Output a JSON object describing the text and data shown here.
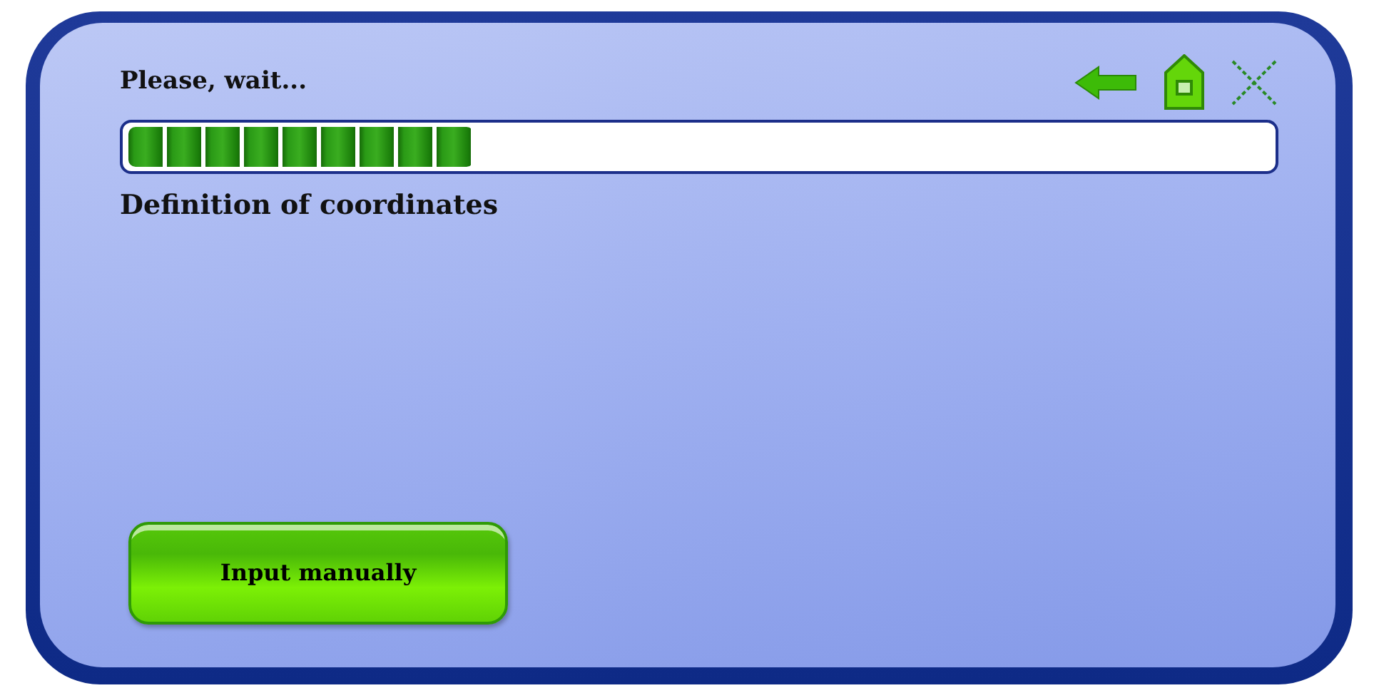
{
  "title": "Please, wait...",
  "progress": {
    "level": 0.3
  },
  "status": "Definition of coordinates",
  "buttons": [
    {
      "label": "Input manually"
    }
  ]
}
